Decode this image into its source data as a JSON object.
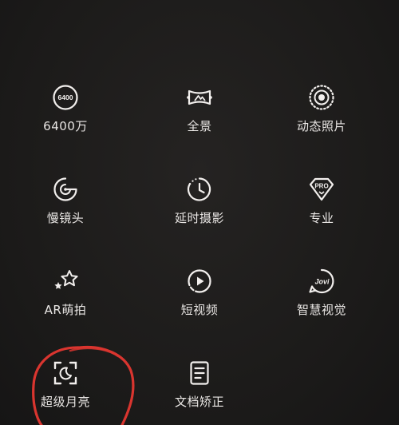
{
  "modes": [
    {
      "label": "6400万",
      "icon": "6400-badge-icon"
    },
    {
      "label": "全景",
      "icon": "panorama-icon"
    },
    {
      "label": "动态照片",
      "icon": "live-photo-icon"
    },
    {
      "label": "慢镜头",
      "icon": "slow-motion-icon"
    },
    {
      "label": "延时摄影",
      "icon": "timelapse-icon"
    },
    {
      "label": "专业",
      "icon": "pro-icon"
    },
    {
      "label": "AR萌拍",
      "icon": "ar-stars-icon"
    },
    {
      "label": "短视频",
      "icon": "short-video-icon"
    },
    {
      "label": "智慧视觉",
      "icon": "jovi-icon"
    },
    {
      "label": "超级月亮",
      "icon": "super-moon-icon"
    },
    {
      "label": "文档矫正",
      "icon": "document-icon"
    }
  ],
  "badges": {
    "megapixel": "6400",
    "pro": "PRO",
    "jovi": "Jovi"
  },
  "colors": {
    "background": "#1c1a1a",
    "icon_stroke": "#f2efed",
    "label": "#e9e6e4",
    "annotation": "#d9352f"
  }
}
